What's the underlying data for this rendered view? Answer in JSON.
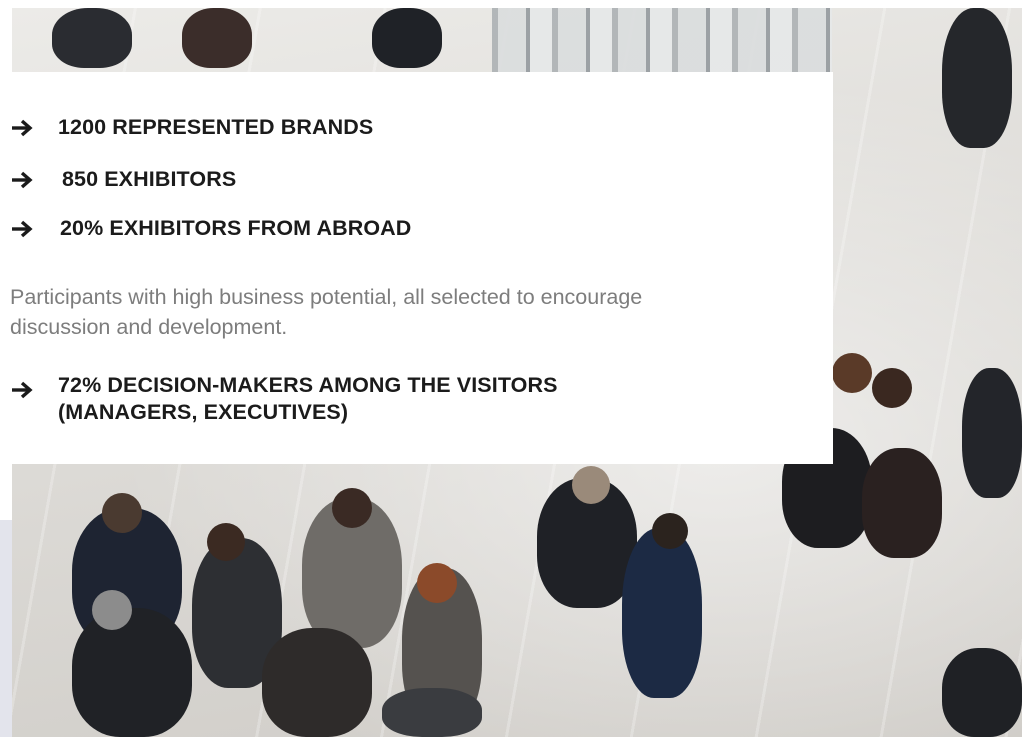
{
  "highlights": {
    "items": [
      {
        "text": "1200 REPRESENTED BRANDS"
      },
      {
        "text": "850 EXHIBITORS"
      },
      {
        "text": "20% EXHIBITORS FROM ABROAD"
      }
    ],
    "description": "Participants with high business potential, all selected to encourage discussion and development.",
    "visitors": {
      "line1": "72% DECISION-MAKERS AMONG THE VISITORS",
      "line2": "(MANAGERS, EXECUTIVES)"
    }
  },
  "icons": {
    "bullet": "right-arrow-icon"
  },
  "colors": {
    "heading_text": "#1b1b1b",
    "body_text": "#7d7d7d",
    "panel": "#ffffff"
  }
}
